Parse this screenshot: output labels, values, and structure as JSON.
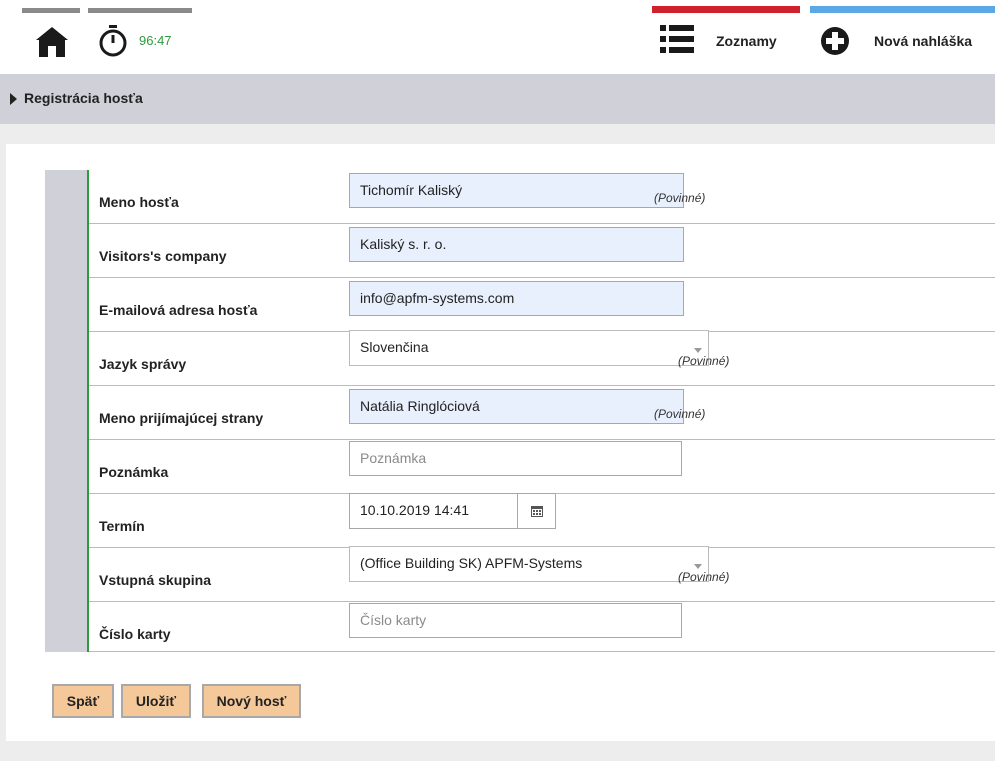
{
  "header": {
    "timer": "96:47",
    "lists_label": "Zoznamy",
    "new_label": "Nová nahláška",
    "colors": {
      "red_accent": "#d0212f",
      "blue_accent": "#5ba8e6",
      "timer_green": "#2e9b3a"
    }
  },
  "breadcrumb": {
    "label": "Registrácia hosťa"
  },
  "form": {
    "required_text": "(Povinné)",
    "fields": [
      {
        "label": "Meno hosťa",
        "value": "Tichomír Kaliský",
        "required": true
      },
      {
        "label": "Visitors's company",
        "value": "Kaliský s. r. o.",
        "required": false
      },
      {
        "label": "E-mailová adresa hosťa",
        "value": "info@apfm-systems.com",
        "required": false
      },
      {
        "label": "Jazyk správy",
        "value": "Slovenčina",
        "type": "select",
        "required": true
      },
      {
        "label": "Meno prijímajúcej strany",
        "value": "Natália Ringlóciová",
        "required": true
      },
      {
        "label": "Poznámka",
        "value": "",
        "placeholder": "Poznámka",
        "required": false
      },
      {
        "label": "Termín",
        "value": "10.10.2019 14:41",
        "type": "datetime",
        "required": false
      },
      {
        "label": "Vstupná skupina",
        "value": "(Office Building SK) APFM-Systems",
        "type": "select",
        "required": true
      },
      {
        "label": "Číslo karty",
        "value": "",
        "placeholder": "Číslo karty",
        "required": false
      }
    ]
  },
  "buttons": {
    "back": "Späť",
    "save": "Uložiť",
    "new_guest": "Nový hosť"
  },
  "icons": [
    "home-icon",
    "stopwatch-icon",
    "list-icon",
    "plus-circle-icon",
    "calendar-icon",
    "chevron-right-icon",
    "chevron-down-icon"
  ]
}
